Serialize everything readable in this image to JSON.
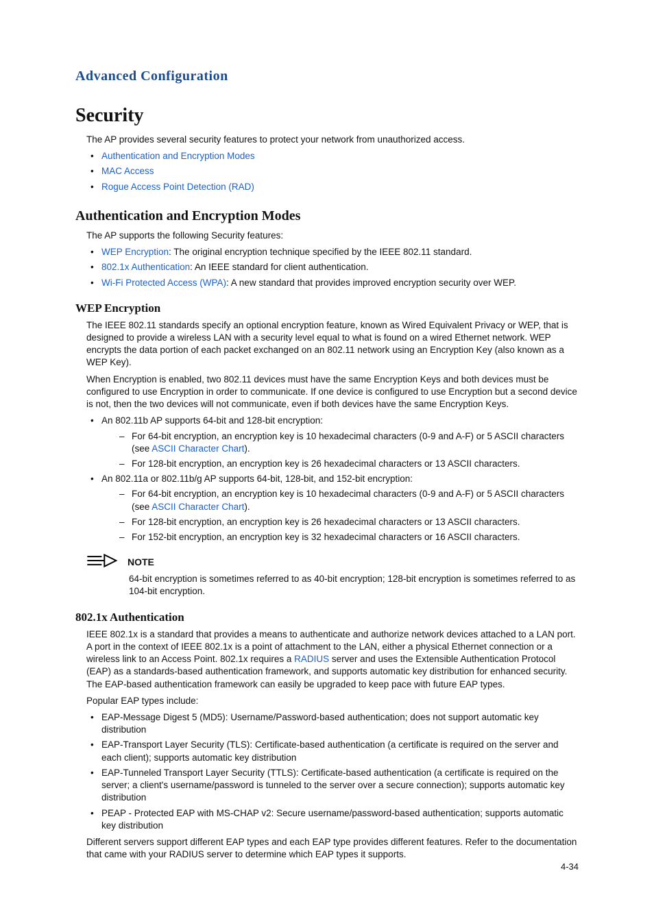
{
  "runningHead": "Advanced Configuration",
  "pageNumber": "4-34",
  "security": {
    "title": "Security",
    "intro": "The AP provides several security features to protect your network from unauthorized access.",
    "topLinks": [
      "Authentication and Encryption Modes",
      "MAC Access",
      "Rogue Access Point Detection (RAD)"
    ]
  },
  "authEnc": {
    "title": "Authentication and Encryption Modes",
    "intro": "The AP supports the following Security features:",
    "features": [
      {
        "link": "WEP Encryption",
        "rest": ": The original encryption technique specified by the IEEE 802.11 standard."
      },
      {
        "link": "802.1x Authentication",
        "rest": ": An IEEE standard for client authentication."
      },
      {
        "link": "Wi-Fi Protected Access (WPA)",
        "rest": ": A new standard that provides improved encryption security over WEP."
      }
    ]
  },
  "wep": {
    "title": "WEP Encryption",
    "p1": "The IEEE 802.11 standards specify an optional encryption feature, known as Wired Equivalent Privacy or WEP, that is designed to provide a wireless LAN with a security level equal to what is found on a wired Ethernet network. WEP encrypts the data portion of each packet exchanged on an 802.11 network using an Encryption Key (also known as a WEP Key).",
    "p2": "When Encryption is enabled, two 802.11 devices must have the same Encryption Keys and both devices must be configured to use Encryption in order to communicate. If one device is configured to use Encryption but a second device is not, then the two devices will not communicate, even if both devices have the same Encryption Keys.",
    "b1": "An 802.11b AP supports 64-bit and 128-bit encryption:",
    "b1_d1_pre": "For 64-bit encryption, an encryption key is 10 hexadecimal characters (0-9 and A-F) or 5 ASCII characters (see ",
    "b1_d1_link": "ASCII Character Chart",
    "b1_d1_post": ").",
    "b1_d2": "For 128-bit encryption, an encryption key is 26 hexadecimal characters or 13 ASCII characters.",
    "b2": "An 802.11a or 802.11b/g AP supports 64-bit, 128-bit, and 152-bit encryption:",
    "b2_d1_pre": "For 64-bit encryption, an encryption key is 10 hexadecimal characters (0-9 and A-F) or 5 ASCII characters (see ",
    "b2_d1_link": "ASCII Character Chart",
    "b2_d1_post": ").",
    "b2_d2": "For 128-bit encryption, an encryption key is 26 hexadecimal characters or 13 ASCII characters.",
    "b2_d3": "For 152-bit encryption, an encryption key is 32 hexadecimal characters or 16 ASCII characters."
  },
  "note": {
    "label": "NOTE",
    "body": "64-bit encryption is sometimes referred to as 40-bit encryption; 128-bit encryption is sometimes referred to as 104-bit encryption."
  },
  "dot1x": {
    "title": "802.1x Authentication",
    "p1_pre": "IEEE 802.1x is a standard that provides a means to authenticate and authorize network devices attached to a LAN port. A port in the context of IEEE 802.1x is a point of attachment to the LAN, either a physical Ethernet connection or a wireless link to an Access Point. 802.1x requires a ",
    "p1_link": "RADIUS",
    "p1_post": " server and uses the Extensible Authentication Protocol (EAP) as a standards-based authentication framework, and supports automatic key distribution for enhanced security. The EAP-based authentication framework can easily be upgraded to keep pace with future EAP types.",
    "p2": "Popular EAP types include:",
    "bullets": [
      "EAP-Message Digest 5 (MD5): Username/Password-based authentication; does not support automatic key distribution",
      "EAP-Transport Layer Security (TLS): Certificate-based authentication (a certificate is required on the server and each client); supports automatic key distribution",
      "EAP-Tunneled Transport Layer Security (TTLS): Certificate-based authentication (a certificate is required on the server; a client's username/password is tunneled to the server over a secure connection); supports automatic key distribution",
      "PEAP - Protected EAP with MS-CHAP v2: Secure username/password-based authentication; supports automatic key distribution"
    ],
    "p3": "Different servers support different EAP types and each EAP type provides different features. Refer to the documentation that came with your RADIUS server to determine which EAP types it supports."
  }
}
